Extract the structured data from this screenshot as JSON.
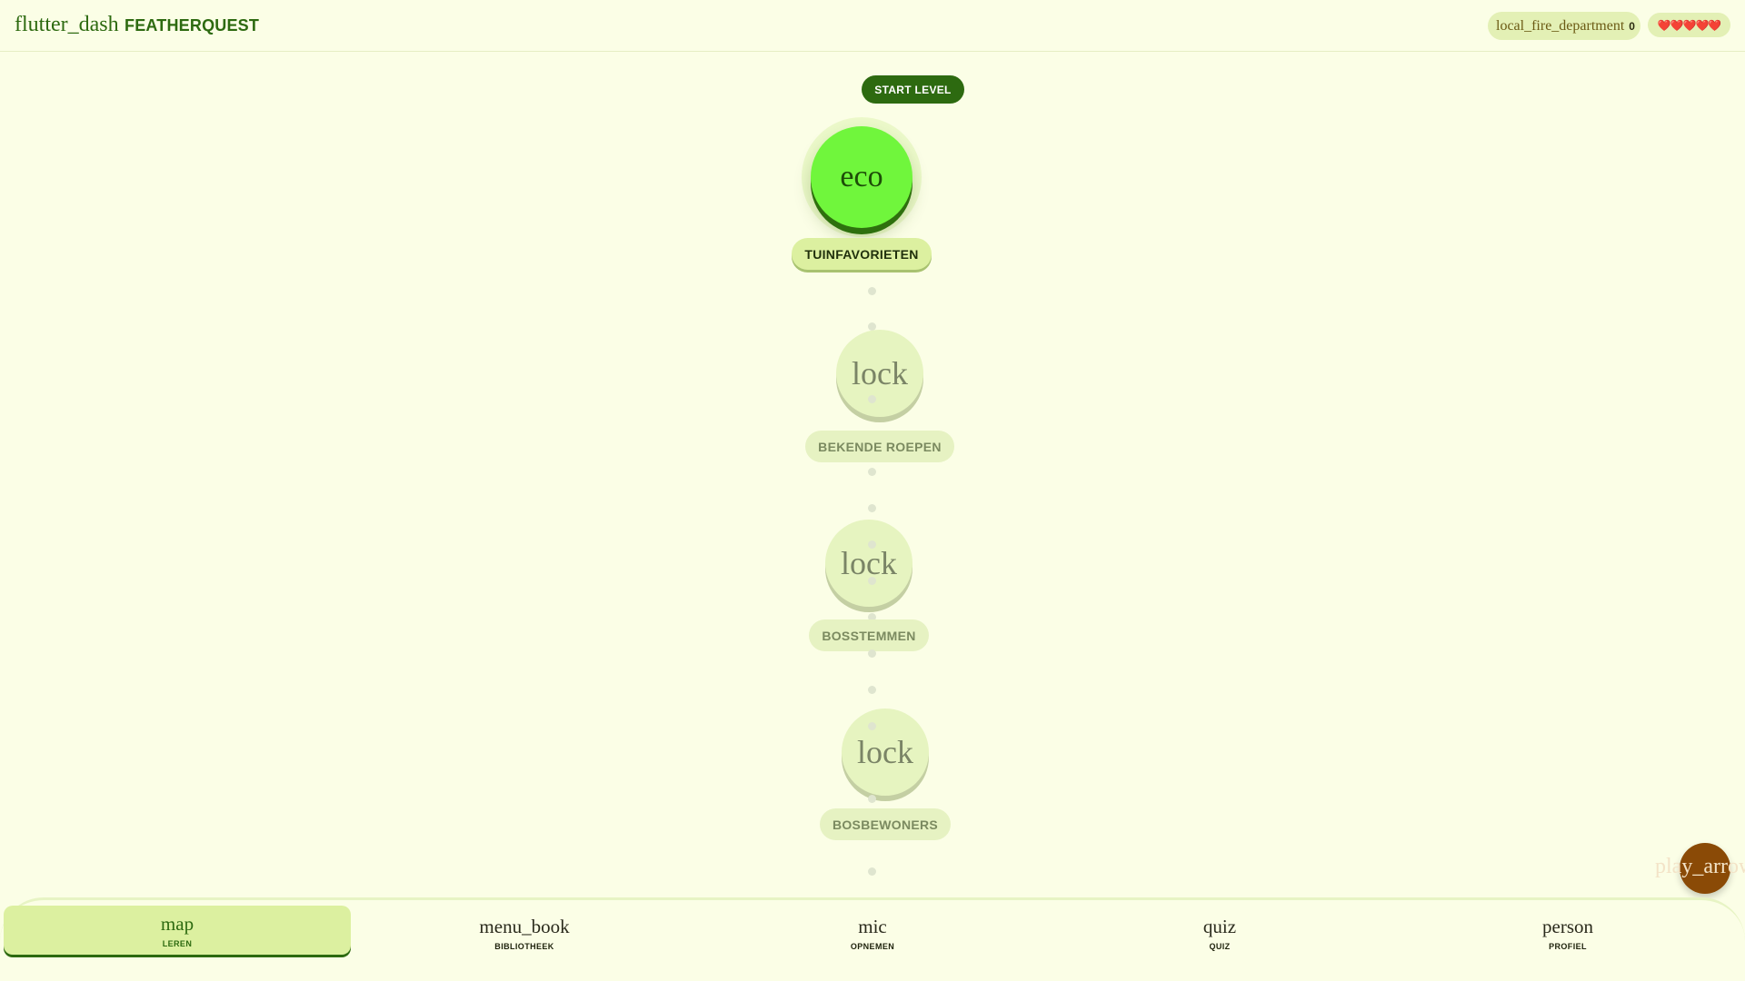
{
  "header": {
    "brand_icon": "flutter_dash",
    "title": "FEATHERQUEST",
    "streak_icon": "local_fire_department",
    "streak_count": "0",
    "hearts": "❤️❤️❤️❤️❤️"
  },
  "map": {
    "start_label": "START LEVEL",
    "levels": [
      {
        "icon": "eco",
        "label": "TUINFAVORIETEN",
        "state": "unlocked"
      },
      {
        "icon": "lock",
        "label": "BEKENDE ROEPEN",
        "state": "locked"
      },
      {
        "icon": "lock",
        "label": "BOSSTEMMEN",
        "state": "locked"
      },
      {
        "icon": "lock",
        "label": "BOSBEWONERS",
        "state": "locked"
      }
    ]
  },
  "fab": {
    "icon": "play_arrow"
  },
  "nav": {
    "items": [
      {
        "icon": "map",
        "label": "LEREN",
        "active": true
      },
      {
        "icon": "menu_book",
        "label": "BIBLIOTHEEK",
        "active": false
      },
      {
        "icon": "mic",
        "label": "OPNEMEN",
        "active": false
      },
      {
        "icon": "quiz",
        "label": "QUIZ",
        "active": false
      },
      {
        "icon": "person",
        "label": "PROFIEL",
        "active": false
      }
    ]
  },
  "colors": {
    "background": "#fbfee6",
    "primary": "#2d6a10",
    "active_node": "#70f63c",
    "locked_node": "#e6f4c0",
    "fab": "#8a4a06",
    "hearts": "#e0242b"
  }
}
